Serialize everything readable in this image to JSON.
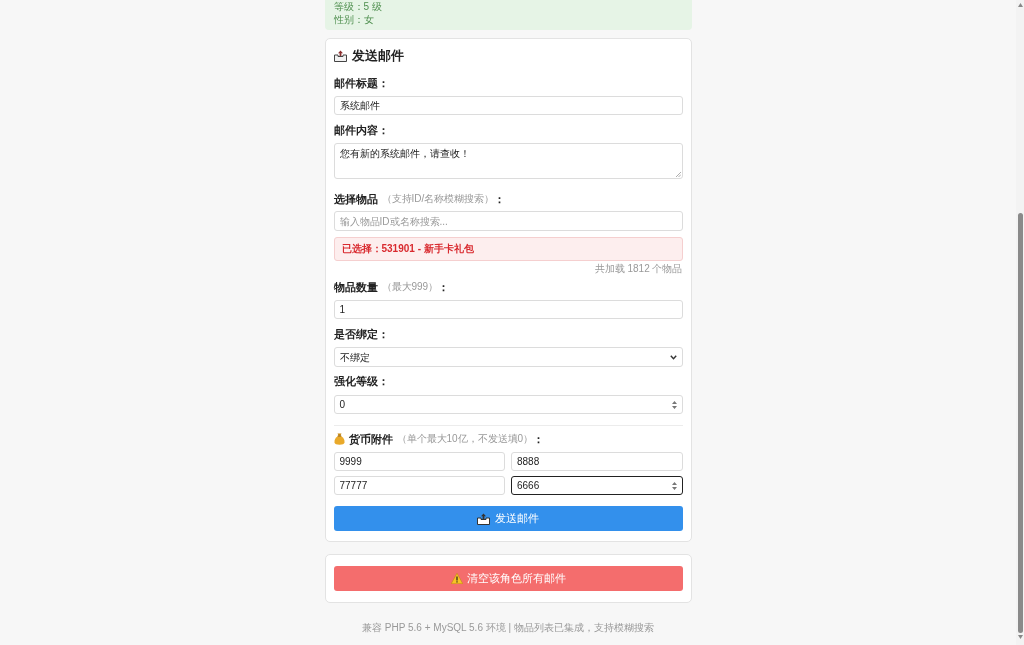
{
  "info_box": {
    "lines": [
      "等级：5 级",
      "性别：女"
    ]
  },
  "send_mail": {
    "title": "发送邮件",
    "subject": {
      "label": "邮件标题：",
      "value": "系统邮件"
    },
    "content": {
      "label": "邮件内容：",
      "value": "您有新的系统邮件，请查收！"
    },
    "item": {
      "label": "选择物品",
      "hint": "（支持ID/名称模糊搜索）",
      "colon": "：",
      "placeholder": "输入物品ID或名称搜索...",
      "selected_text": "已选择：531901 - 新手卡礼包",
      "count_text": "共加载 1812 个物品"
    },
    "quantity": {
      "label": "物品数量",
      "hint": "（最大999）",
      "colon": "：",
      "value": "1"
    },
    "bind": {
      "label": "是否绑定：",
      "value": "不绑定"
    },
    "enhance": {
      "label": "强化等级：",
      "value": "0"
    },
    "currency": {
      "label": "货币附件",
      "hint": "（单个最大10亿，不发送填0）",
      "colon": "：",
      "fields": [
        {
          "value": "9999",
          "focused": false
        },
        {
          "value": "8888",
          "focused": false
        },
        {
          "value": "77777",
          "focused": false
        },
        {
          "value": "6666",
          "focused": true
        }
      ]
    },
    "submit_button": "发送邮件"
  },
  "clear_card": {
    "button": "清空该角色所有邮件"
  },
  "footer": "兼容 PHP 5.6 + MySQL 5.6 环境 | 物品列表已集成，支持模糊搜索"
}
